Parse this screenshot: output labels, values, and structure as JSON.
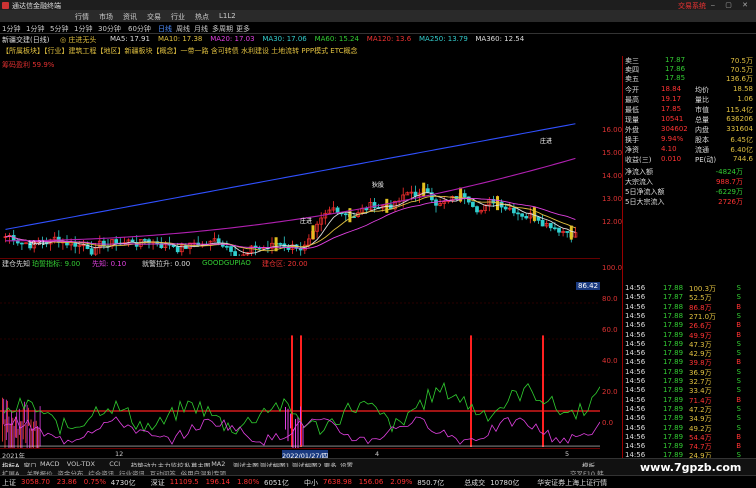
{
  "title": "通达信金融终端",
  "titlebar_right": "交易系统",
  "menu": [
    "行情",
    "市场",
    "资讯",
    "交易",
    "行业",
    "热点",
    "L1L2"
  ],
  "periods": [
    "1分钟",
    "1分钟",
    "5分钟",
    "1分钟",
    "30分钟",
    "60分钟",
    "日线",
    "周线",
    "月线",
    "多周期",
    "更多"
  ],
  "symbol": "新疆交建(日线)",
  "pref": "◎ 庄进无头",
  "ma": [
    {
      "t": "MA5: 17.91",
      "c": "#ddd"
    },
    {
      "t": "MA10: 17.38",
      "c": "#e0c040"
    },
    {
      "t": "MA20: 17.03",
      "c": "#e040e0"
    },
    {
      "t": "MA30: 17.06",
      "c": "#3cc"
    },
    {
      "t": "MA60: 15.24",
      "c": "#3c3"
    },
    {
      "t": "MA120: 13.6",
      "c": "#e33"
    },
    {
      "t": "MA250: 13.79",
      "c": "#3cc"
    },
    {
      "t": "MA360: 12.54",
      "c": "#ddd"
    }
  ],
  "tags": "【所属板块】【行业】建筑工程【地区】新疆板块【概念】一带一路 含可转债 水利建设 土地流转 PPP模式 ETC概念",
  "chip": "筹码盈利 59.9%",
  "price_axis": [
    "16.00",
    "15.00",
    "14.00",
    "13.00",
    "12.00"
  ],
  "annot": {
    "a": "庄进",
    "b": "狄股",
    "c": "10.31",
    "d": "庄进"
  },
  "ind_head": [
    {
      "t": "建仓先知",
      "c": "#ddd"
    },
    {
      "t": "珀誓指标: 9.00",
      "c": "#3c3"
    },
    {
      "t": "先知: 0.10",
      "c": "#e040e0"
    },
    {
      "t": "就警拉升: 0.00",
      "c": "#ddd"
    },
    {
      "t": "GOODGUPIAO",
      "c": "#3c3"
    },
    {
      "t": "建仓区: 20.00",
      "c": "#e33"
    }
  ],
  "ind_axis": [
    "100.0",
    "80.0",
    "60.0",
    "40.0",
    "20.0",
    "0.0"
  ],
  "ind_label": "86.42",
  "quote": {
    "sell": [
      {
        "n": "卖三",
        "p": "17.87",
        "v": "70.5万"
      },
      {
        "n": "卖四",
        "p": "17.86",
        "v": "70.5万"
      },
      {
        "n": "卖五",
        "p": "17.85",
        "v": "136.6万"
      }
    ],
    "fields": [
      {
        "a": "今开",
        "av": "18.84",
        "b": "均价",
        "bv": "18.58"
      },
      {
        "a": "最高",
        "av": "19.17",
        "b": "量比",
        "bv": "1.06"
      },
      {
        "a": "最低",
        "av": "17.85",
        "b": "市值",
        "bv": "115.4亿"
      },
      {
        "a": "现量",
        "av": "10541",
        "b": "总量",
        "bv": "636206"
      },
      {
        "a": "外盘",
        "av": "304602",
        "b": "内盘",
        "bv": "331604"
      },
      {
        "a": "换手",
        "av": "9.94%",
        "b": "股本",
        "bv": "6.45亿"
      },
      {
        "a": "净资",
        "av": "4.10",
        "b": "流通",
        "bv": "6.40亿"
      },
      {
        "a": "收益(三)",
        "av": "0.010",
        "b": "PE(动)",
        "bv": "744.6"
      }
    ],
    "flow": [
      {
        "n": "净流入额",
        "v": "-4824万",
        "c": "#33cc33"
      },
      {
        "n": "大宗流入",
        "v": "988.7万",
        "c": "#ff3333"
      },
      {
        "n": "5日净流入额",
        "v": "-6229万",
        "c": "#33cc33"
      },
      {
        "n": "5日大宗流入",
        "v": "2726万",
        "c": "#ff3333"
      }
    ]
  },
  "ticks": [
    [
      "14:56",
      "17.88",
      "100.3万",
      "S"
    ],
    [
      "14:56",
      "17.87",
      "52.5万",
      "S"
    ],
    [
      "14:56",
      "17.88",
      "86.8万",
      "B"
    ],
    [
      "14:56",
      "17.88",
      "271.0万",
      "S"
    ],
    [
      "14:56",
      "17.89",
      "26.6万",
      "B"
    ],
    [
      "14:56",
      "17.89",
      "49.9万",
      "B"
    ],
    [
      "14:56",
      "17.89",
      "47.3万",
      "S"
    ],
    [
      "14:56",
      "17.89",
      "42.9万",
      "S"
    ],
    [
      "14:56",
      "17.89",
      "39.8万",
      "B"
    ],
    [
      "14:56",
      "17.89",
      "36.9万",
      "S"
    ],
    [
      "14:56",
      "17.89",
      "32.7万",
      "S"
    ],
    [
      "14:56",
      "17.89",
      "33.4万",
      "S"
    ],
    [
      "14:56",
      "17.89",
      "71.4万",
      "B"
    ],
    [
      "14:56",
      "17.89",
      "47.2万",
      "S"
    ],
    [
      "14:56",
      "17.89",
      "34.9万",
      "S"
    ],
    [
      "14:56",
      "17.89",
      "49.2万",
      "S"
    ],
    [
      "14:56",
      "17.89",
      "54.4万",
      "B"
    ],
    [
      "14:56",
      "17.89",
      "74.7万",
      "B"
    ],
    [
      "14:56",
      "17.89",
      "24.9万",
      "S"
    ]
  ],
  "dates": [
    "2021年",
    "12",
    "2022/01/27/四",
    "4",
    "5"
  ],
  "tabs1": [
    "指标A",
    "窗口",
    "MACD",
    "VOL-TDX",
    "CCI",
    "趋势动力",
    "主力监控",
    "私募主图",
    "MA2",
    "测试主图",
    "测试幅图1",
    "测试幅图2",
    "更多",
    "设置"
  ],
  "tabs1b": "模板",
  "tabs2": [
    "扩展A",
    "关联报价",
    "资金分布",
    "综合资讯",
    "行业资讯",
    "互动问答",
    "俗用户温利专项"
  ],
  "tabs2b": "交叉F10 韩",
  "status": [
    {
      "t": "上证",
      "c": "#ddd"
    },
    {
      "t": "3058.70",
      "c": "#ff3333"
    },
    {
      "t": "23.86",
      "c": "#ff3333"
    },
    {
      "t": "0.75%",
      "c": "#ff3333"
    },
    {
      "t": "4730亿",
      "c": "#ddd"
    },
    {
      "t": "深证",
      "c": "#ddd"
    },
    {
      "t": "11109.5",
      "c": "#ff3333"
    },
    {
      "t": "196.14",
      "c": "#ff3333"
    },
    {
      "t": "1.80%",
      "c": "#ff3333"
    },
    {
      "t": "6051亿",
      "c": "#ddd"
    },
    {
      "t": "中小",
      "c": "#ddd"
    },
    {
      "t": "7638.98",
      "c": "#ff3333"
    },
    {
      "t": "156.06",
      "c": "#ff3333"
    },
    {
      "t": "2.09%",
      "c": "#ff3333"
    },
    {
      "t": "850.7亿",
      "c": "#ddd"
    },
    {
      "t": "总成交",
      "c": "#ddd"
    },
    {
      "t": "10780亿",
      "c": "#ddd"
    },
    {
      "t": "华安证券上海上证行情",
      "c": "#ddd"
    }
  ],
  "watermark": "www.7gpzb.com"
}
